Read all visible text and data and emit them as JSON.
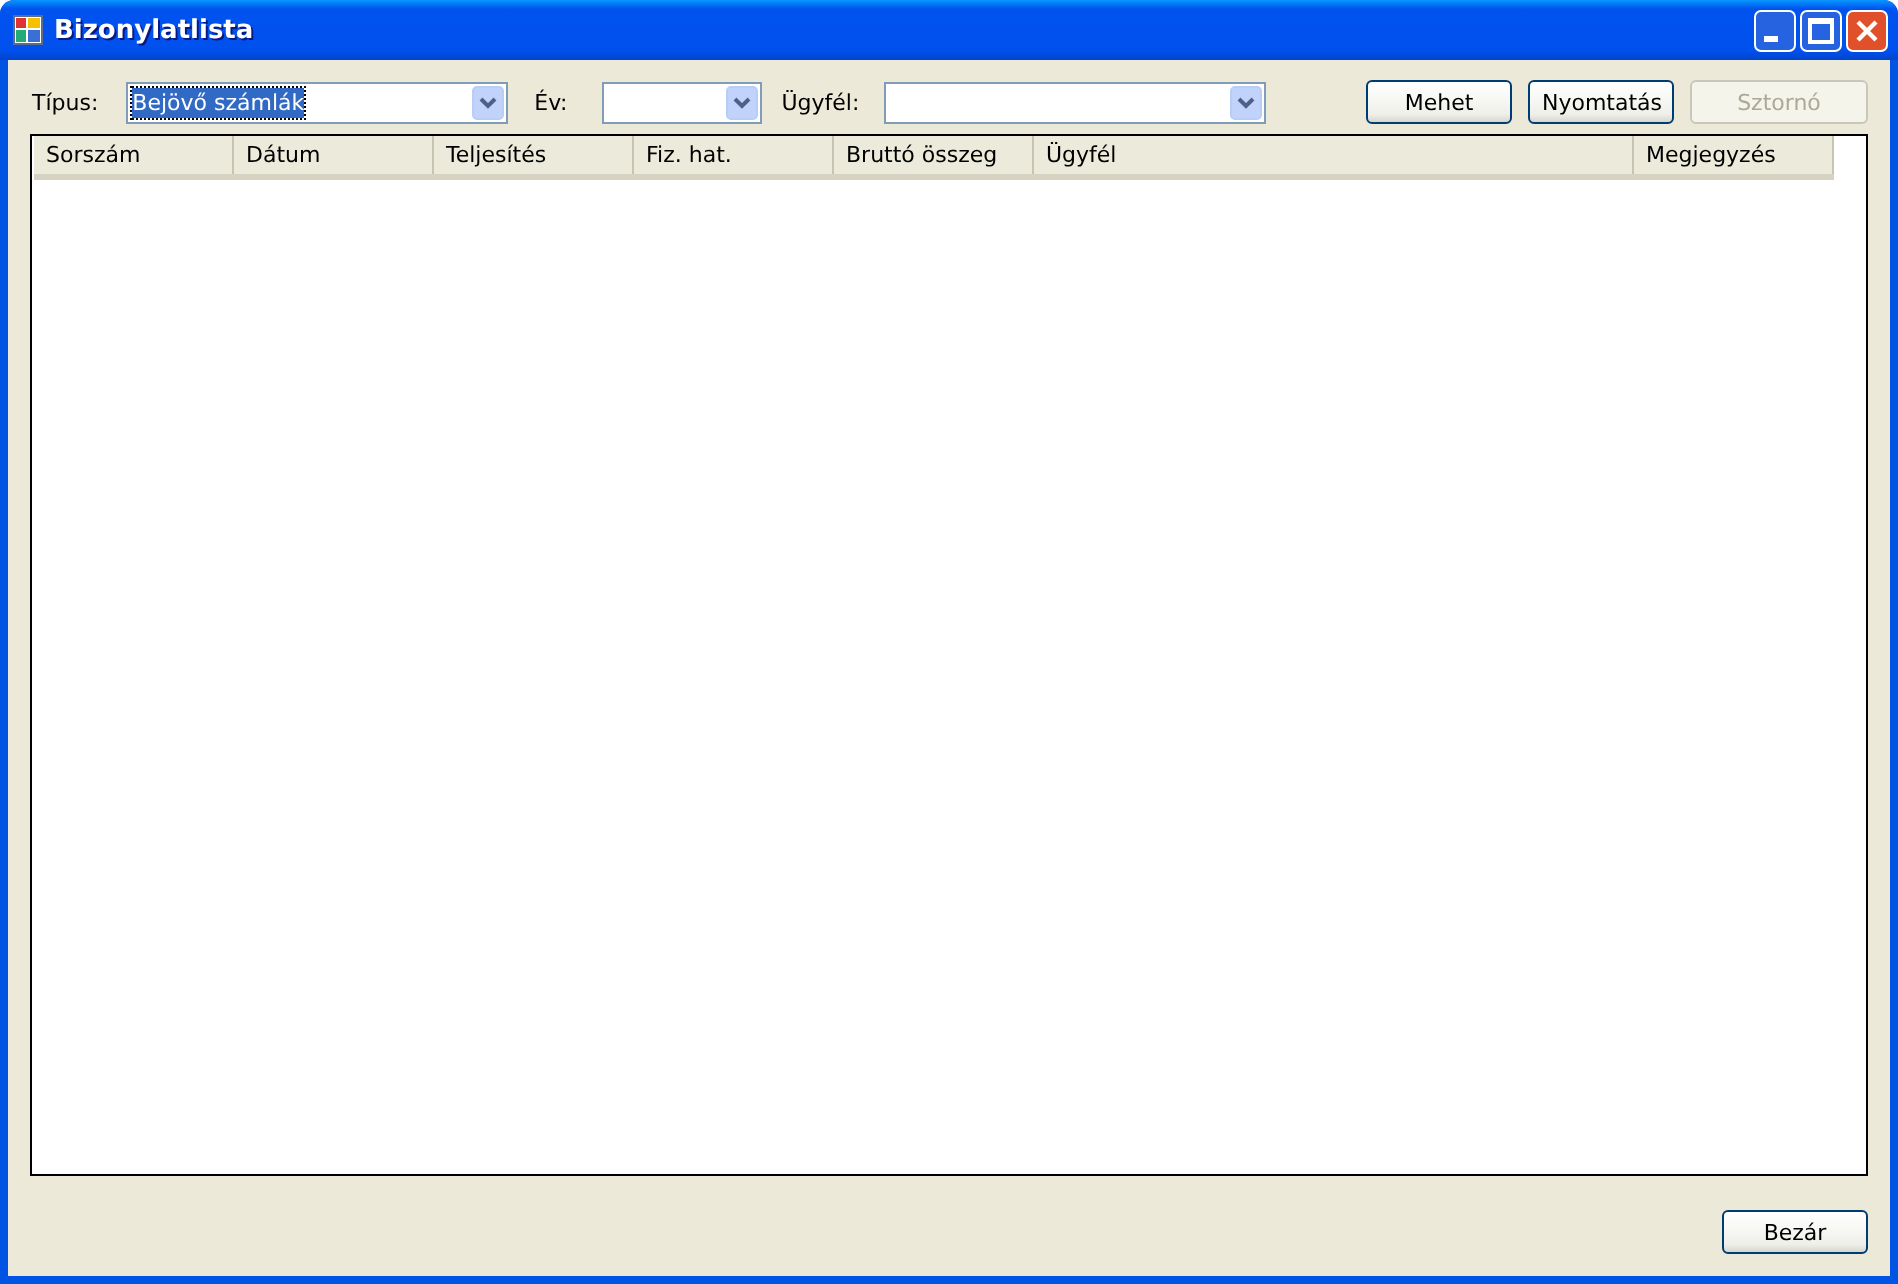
{
  "window": {
    "title": "Bizonylatlista"
  },
  "filters": [
    {
      "label": "Típus:",
      "value": "Bejövő számlák",
      "focused": true
    },
    {
      "label": "Év:",
      "focused": false
    },
    {
      "label": "Ügyfél:",
      "focused": false
    }
  ],
  "buttons": [
    {
      "label": "Mehet",
      "disabled": false
    },
    {
      "label": "Nyomtatás",
      "disabled": false
    },
    {
      "label": "Sztornó",
      "disabled": true
    }
  ],
  "table": {
    "columns": [
      "Sorszám",
      "Dátum",
      "Teljesítés",
      "Fiz. hat.",
      "Bruttó összeg",
      "Ügyfél",
      "Megjegyzés"
    ]
  },
  "footer_buttons": [
    {
      "label": "Bezár",
      "disabled": false
    }
  ]
}
